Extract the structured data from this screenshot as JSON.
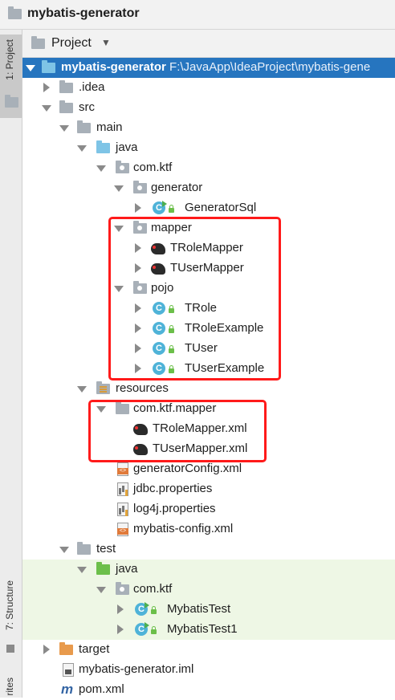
{
  "window": {
    "title": "mybatis-generator"
  },
  "sidebar": {
    "tabs": [
      {
        "label": "1: Project"
      },
      {
        "label": "7: Structure"
      },
      {
        "label": "rites"
      }
    ]
  },
  "project_view": {
    "label": "Project"
  },
  "tree": {
    "root": {
      "name": "mybatis-generator",
      "path": "F:\\JavaApp\\IdeaProject\\mybatis-gene"
    },
    "items": [
      {
        "label": ".idea"
      },
      {
        "label": "src"
      },
      {
        "label": "main"
      },
      {
        "label": "java"
      },
      {
        "label": "com.ktf"
      },
      {
        "label": "generator"
      },
      {
        "label": "GeneratorSql"
      },
      {
        "label": "mapper"
      },
      {
        "label": "TRoleMapper"
      },
      {
        "label": "TUserMapper"
      },
      {
        "label": "pojo"
      },
      {
        "label": "TRole"
      },
      {
        "label": "TRoleExample"
      },
      {
        "label": "TUser"
      },
      {
        "label": "TUserExample"
      },
      {
        "label": "resources"
      },
      {
        "label": "com.ktf.mapper"
      },
      {
        "label": "TRoleMapper.xml"
      },
      {
        "label": "TUserMapper.xml"
      },
      {
        "label": "generatorConfig.xml"
      },
      {
        "label": "jdbc.properties"
      },
      {
        "label": "log4j.properties"
      },
      {
        "label": "mybatis-config.xml"
      },
      {
        "label": "test"
      },
      {
        "label": "java"
      },
      {
        "label": "com.ktf"
      },
      {
        "label": "MybatisTest"
      },
      {
        "label": "MybatisTest1"
      },
      {
        "label": "target"
      },
      {
        "label": "mybatis-generator.iml"
      },
      {
        "label": "pom.xml"
      }
    ]
  },
  "icons": {
    "class": "C",
    "maven": "m"
  },
  "colors": {
    "selection": "#2675bf",
    "highlight_box": "#ff1a1a",
    "test_bg": "#eef7e5"
  }
}
